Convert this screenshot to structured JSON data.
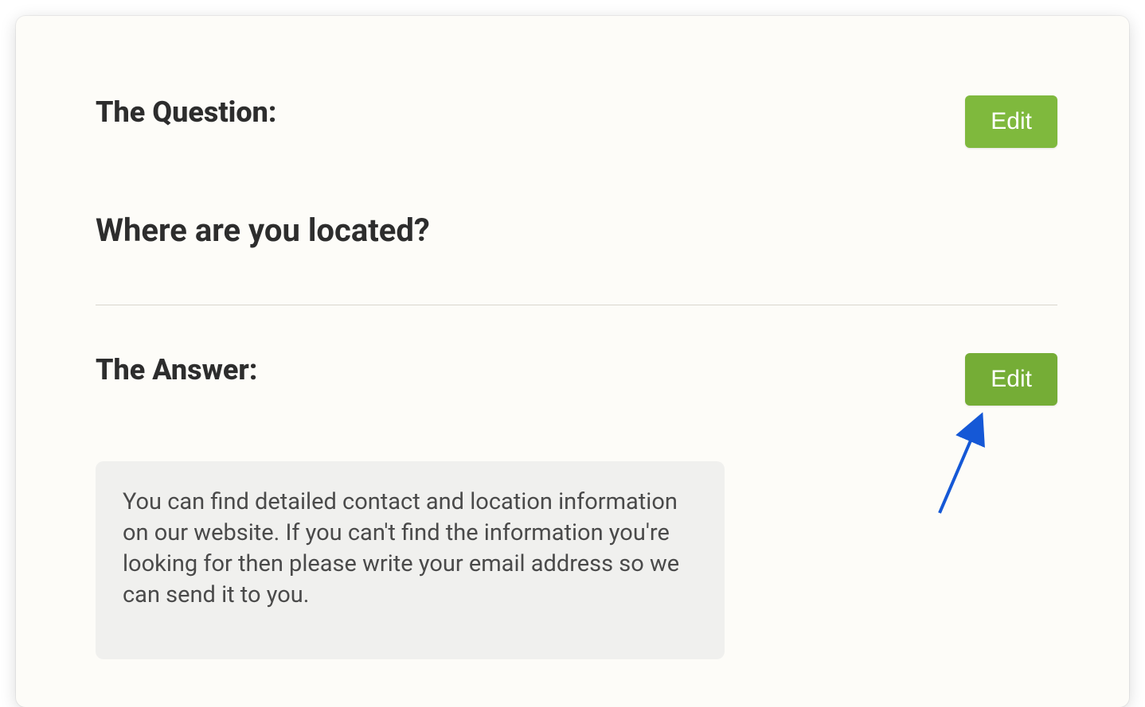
{
  "question": {
    "label": "The Question:",
    "text": "Where are you located?",
    "edit_label": "Edit"
  },
  "answer": {
    "label": "The Answer:",
    "text": "You can find detailed contact and location information on our website. If you can't find the information you're looking for then please write your email address so we can send it to you.",
    "edit_label": "Edit"
  }
}
